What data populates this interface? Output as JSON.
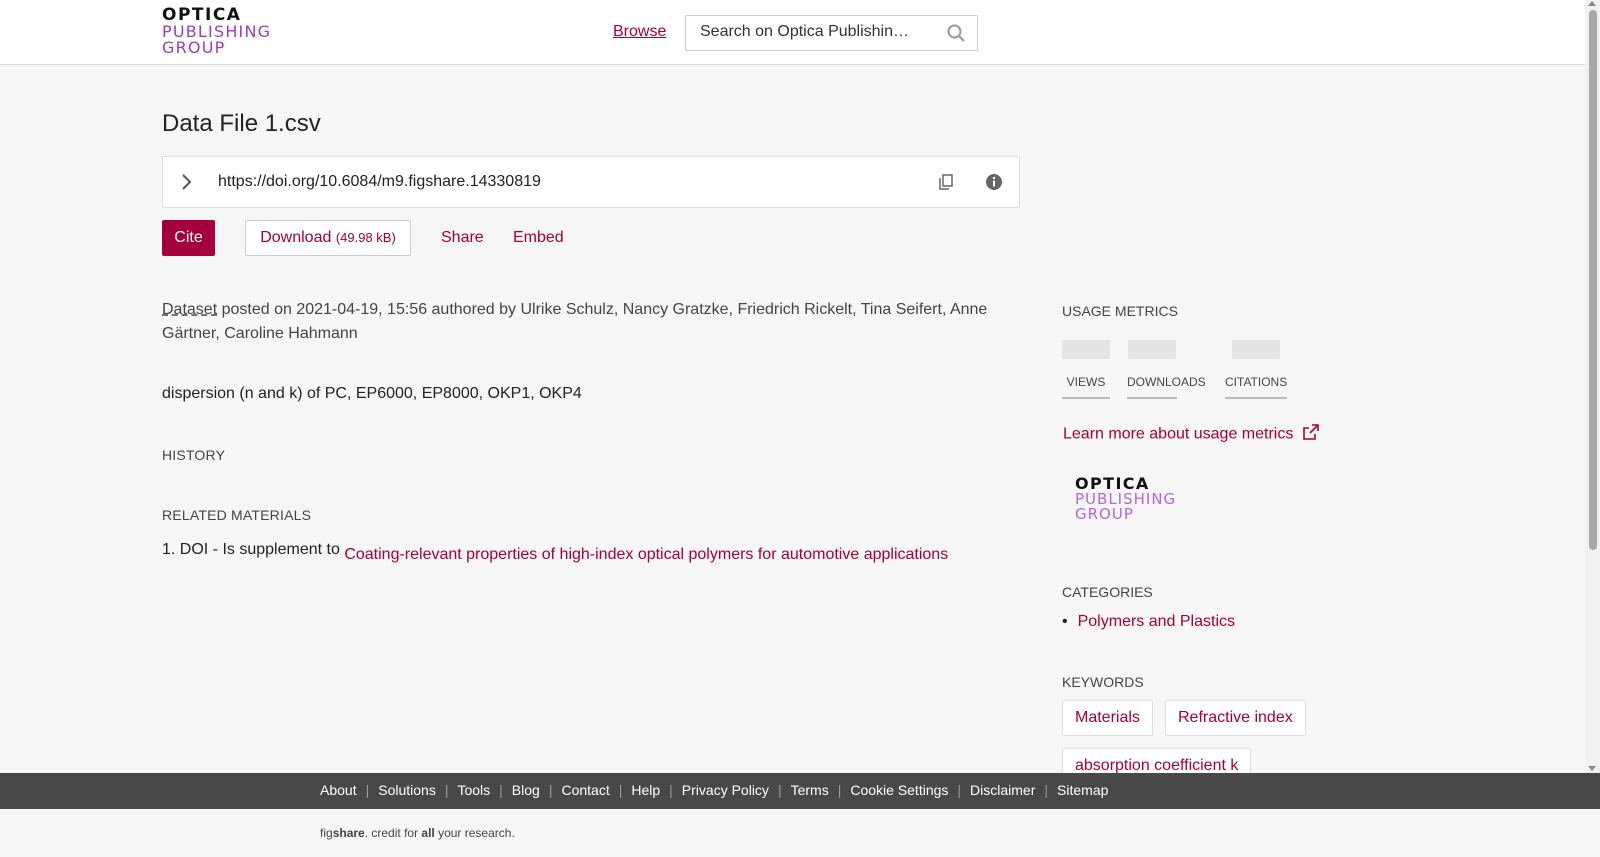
{
  "header": {
    "logo": {
      "line1": "OPTICA",
      "line2": "PUBLISHING",
      "line3": "GROUP"
    },
    "browse_label": "Browse",
    "search_placeholder": "Search on Optica Publishin…"
  },
  "item": {
    "title": "Data File 1.csv",
    "doi": "https://doi.org/10.6084/m9.figshare.14330819",
    "buttons": {
      "cite": "Cite",
      "download": "Download",
      "download_size": "(49.98 kB)",
      "share": "Share",
      "embed": "Embed"
    },
    "meta": {
      "type": "Dataset",
      "posted_text": " posted on 2021-04-19, 15:56 authored by Ulrike Schulz, Nancy Gratzke, Friedrich Rickelt, Tina Seifert, Anne Gärtner, Caroline Hahmann"
    },
    "description": "dispersion (n and k) of PC, EP6000, EP8000, OKP1, OKP4",
    "history_label": "HISTORY",
    "related_label": "RELATED MATERIALS",
    "related": [
      {
        "num": "1.",
        "prefix": "DOI - Is supplement to",
        "link": "Coating-relevant properties of high-index optical polymers for automotive applications"
      }
    ]
  },
  "sidebar": {
    "usage_label": "USAGE METRICS",
    "metrics": [
      "VIEWS",
      "DOWNLOADS",
      "CITATIONS"
    ],
    "learn_more": "Learn more about usage metrics",
    "logo": {
      "line1": "OPTICA",
      "line2": "PUBLISHING",
      "line3": "GROUP"
    },
    "categories_label": "CATEGORIES",
    "categories": [
      "Polymers and Plastics"
    ],
    "keywords_label": "KEYWORDS",
    "keywords": [
      "Materials",
      "Refractive index",
      "absorption coefficient k"
    ]
  },
  "footer": {
    "links": [
      "About",
      "Solutions",
      "Tools",
      "Blog",
      "Contact",
      "Help",
      "Privacy Policy",
      "Terms",
      "Cookie Settings",
      "Disclaimer",
      "Sitemap"
    ],
    "tagline": {
      "fig": "fig",
      "share": "share",
      "mid": ". credit for ",
      "all": "all",
      "end": " your research."
    }
  },
  "colors": {
    "accent": "#a3003c",
    "brand_purple": "#9c3bc2",
    "footer_bg": "#484848"
  }
}
